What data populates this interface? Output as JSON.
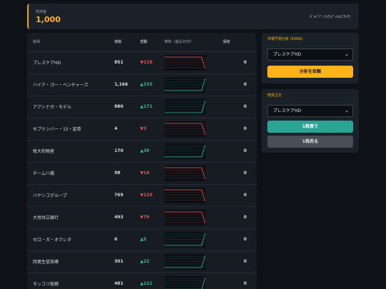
{
  "header": {
    "holdings_label": "所持金",
    "holdings_value": "1,000",
    "right_text": "ｷﾞｬﾊﾞﾃﾞｧﾌｧｳﾝﾃﾞｨﾙﾊ(ﾆﾁｬｱ)"
  },
  "table": {
    "headers": [
      "銘柄",
      "価格",
      "変動",
      "推移（最近20件）",
      "保有"
    ],
    "rows": [
      {
        "name": "プレスケアHD",
        "price": "851",
        "change": "▼118",
        "dir": "down",
        "holding": "0"
      },
      {
        "name": "ハイク・ゴー・ベンチャーズ",
        "price": "1,166",
        "change": "▲333",
        "dir": "up",
        "holding": "0"
      },
      {
        "name": "アアシナガ・モデル",
        "price": "880",
        "change": "▲171",
        "dir": "up",
        "holding": "0"
      },
      {
        "name": "セプテンバー・15・証券",
        "price": "4",
        "change": "▼3",
        "dir": "down",
        "holding": "0"
      },
      {
        "name": "牧大和物産",
        "price": "170",
        "change": "▲39",
        "dir": "up",
        "holding": "0"
      },
      {
        "name": "チーム八橋",
        "price": "98",
        "change": "▼14",
        "dir": "down",
        "holding": "0"
      },
      {
        "name": "ハヤシコグループ",
        "price": "769",
        "change": "▼129",
        "dir": "down",
        "holding": "0"
      },
      {
        "name": "大垣共立銀行",
        "price": "493",
        "change": "▼79",
        "dir": "down",
        "holding": "0"
      },
      {
        "name": "セロ・ガ・オクレタ",
        "price": "6",
        "change": "▲5",
        "dir": "up",
        "holding": "0"
      },
      {
        "name": "岡島生徒指導",
        "price": "301",
        "change": "▲22",
        "dir": "up",
        "holding": "0"
      },
      {
        "name": "モッコリ総務",
        "price": "481",
        "change": "▲121",
        "dir": "up",
        "holding": "0"
      }
    ]
  },
  "forecast": {
    "title": "市場予測分析 (50HG)",
    "selected": "プレスケアHD",
    "button": "分析を依頼"
  },
  "order": {
    "title": "売買注文",
    "selected": "プレスケアHD",
    "buy": "1株買う",
    "sell": "1株売る"
  },
  "colors": {
    "up": "#2fbf8e",
    "down": "#ef4f4f",
    "accent": "#ffb21a"
  }
}
